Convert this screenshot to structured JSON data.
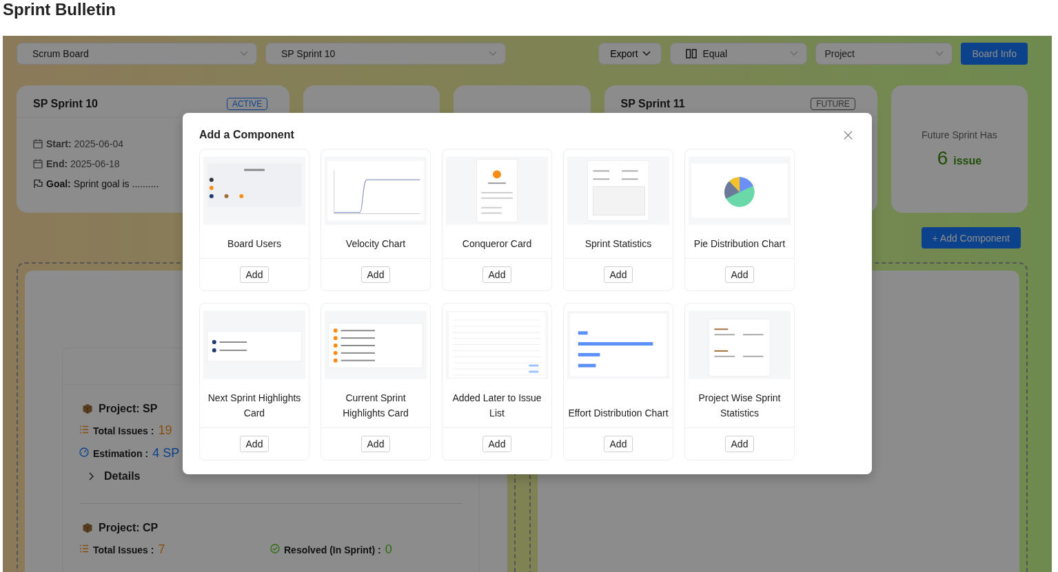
{
  "page": {
    "title": "Sprint Bulletin"
  },
  "toolbar": {
    "board_select": "Scrum Board",
    "sprint_select": "SP Sprint 10",
    "export": "Export",
    "layout_select": "Equal",
    "project_select": {
      "placeholder": "Project"
    },
    "board_info": "Board Info"
  },
  "sprint_cards": [
    {
      "kind": "sprint",
      "title": "SP Sprint 10",
      "status": {
        "label": "ACTIVE",
        "kind": "active"
      },
      "fields": [
        {
          "kind": "date",
          "label": "Start:",
          "value": "2025-06-04"
        },
        {
          "kind": "date",
          "label": "End:",
          "value": "2025-06-18"
        },
        {
          "kind": "goal",
          "label": "Goal:",
          "value": "Sprint goal is .........."
        }
      ]
    },
    {
      "kind": "empty"
    },
    {
      "kind": "empty"
    },
    {
      "kind": "sprint",
      "title": "SP Sprint 11",
      "status": {
        "label": "FUTURE",
        "kind": "future"
      }
    },
    {
      "kind": "count",
      "caption": "Future Sprint Has",
      "number": "6",
      "unit": "issue"
    }
  ],
  "add_component_button": "+ Add Component",
  "projects": [
    {
      "title": "Project: SP",
      "rows": [
        {
          "cells": [
            {
              "kind": "total",
              "label": "Total Issues :",
              "value": "19"
            }
          ]
        },
        {
          "cells": [
            {
              "kind": "estimation",
              "label": "Estimation :",
              "value": "4 SP"
            }
          ]
        }
      ],
      "details": "Details"
    },
    {
      "title": "Project: CP",
      "rows": [
        {
          "cells": [
            {
              "kind": "total",
              "label": "Total Issues :",
              "value": "7"
            },
            {
              "kind": "resolved",
              "label": "Resolved (In Sprint) :",
              "value": "0"
            }
          ]
        }
      ]
    }
  ],
  "dialog": {
    "title": "Add a Component",
    "components": [
      {
        "name": "Board Users",
        "kind": "users",
        "button": "Add"
      },
      {
        "name": "Velocity Chart",
        "kind": "line",
        "button": "Add"
      },
      {
        "name": "Conqueror Card",
        "kind": "profile",
        "button": "Add"
      },
      {
        "name": "Sprint Statistics",
        "kind": "stats",
        "button": "Add"
      },
      {
        "name": "Pie Distribution Chart",
        "kind": "pie",
        "button": "Add"
      },
      {
        "name": "Next Sprint Highlights Card",
        "kind": "list",
        "button": "Add"
      },
      {
        "name": "Current Sprint Highlights Card",
        "kind": "highlights",
        "button": "Add"
      },
      {
        "name": "Added Later to Issue List",
        "kind": "table",
        "button": "Add"
      },
      {
        "name": "Effort Distribution Chart",
        "kind": "bars",
        "button": "Add"
      },
      {
        "name": "Project Wise Sprint Statistics",
        "kind": "projects",
        "button": "Add"
      }
    ]
  }
}
